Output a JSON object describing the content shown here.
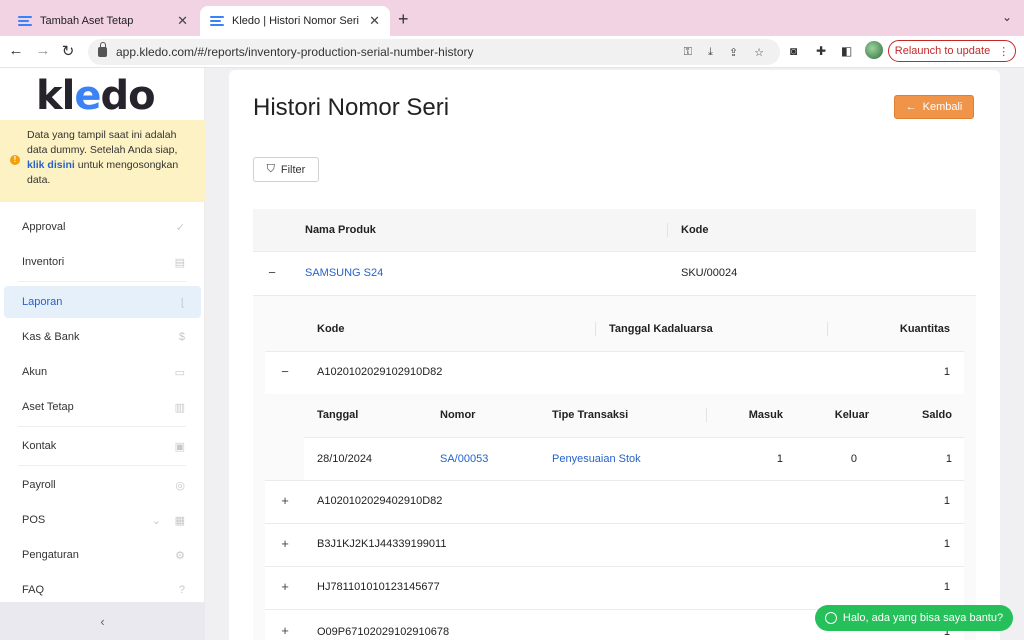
{
  "browser": {
    "tabs": [
      {
        "title": "Tambah Aset Tetap",
        "active": false
      },
      {
        "title": "Kledo | Histori Nomor Seri",
        "active": true
      }
    ],
    "url": "app.kledo.com/#/reports/inventory-production-serial-number-history",
    "relaunch_label": "Relaunch to update"
  },
  "sidebar": {
    "logo_pre": "kl",
    "logo_e": "e",
    "logo_post": "do",
    "notice": {
      "text_1": "Data yang tampil saat ini adalah data dummy. Setelah Anda siap,",
      "link": "klik disini",
      "text_2": "untuk mengosongkan data."
    },
    "items": [
      {
        "label": "Approval",
        "icon": "check-icon"
      },
      {
        "label": "Inventori",
        "icon": "box-icon"
      },
      {
        "label": "Laporan",
        "icon": "chart-icon",
        "active": true
      },
      {
        "label": "Kas & Bank",
        "icon": "dollar-icon"
      },
      {
        "label": "Akun",
        "icon": "list-icon"
      },
      {
        "label": "Aset Tetap",
        "icon": "building-icon"
      },
      {
        "label": "Kontak",
        "icon": "contact-card-icon"
      },
      {
        "label": "Payroll",
        "icon": "payroll-icon"
      },
      {
        "label": "POS",
        "icon": "pos-icon"
      },
      {
        "label": "Pengaturan",
        "icon": "gears-icon"
      },
      {
        "label": "FAQ",
        "icon": "question-icon"
      }
    ],
    "collapse_icon": "‹"
  },
  "page": {
    "title": "Histori Nomor Seri",
    "back_label": "Kembali",
    "filter_label": "Filter"
  },
  "product_table": {
    "headers": {
      "name": "Nama Produk",
      "code": "Kode"
    },
    "row": {
      "name": "SAMSUNG S24",
      "code": "SKU/00024",
      "toggle": "−"
    }
  },
  "serial_table": {
    "headers": {
      "code": "Kode",
      "expiry": "Tanggal Kadaluarsa",
      "qty": "Kuantitas"
    },
    "rows": [
      {
        "code": "A1020102029102910D82",
        "qty": "1",
        "toggle": "−"
      },
      {
        "code": "A1020102029402910D82",
        "qty": "1",
        "toggle": "+"
      },
      {
        "code": "B3J1KJ2K1J44339199011",
        "qty": "1",
        "toggle": "+"
      },
      {
        "code": "HJ781101010123145677",
        "qty": "1",
        "toggle": "+"
      },
      {
        "code": "O09P67102029102910678",
        "qty": "1",
        "toggle": "+"
      }
    ]
  },
  "transaction_table": {
    "headers": {
      "date": "Tanggal",
      "number": "Nomor",
      "type": "Tipe Transaksi",
      "in": "Masuk",
      "out": "Keluar",
      "balance": "Saldo"
    },
    "rows": [
      {
        "date": "28/10/2024",
        "number": "SA/00053",
        "type": "Penyesuaian Stok",
        "in": "1",
        "out": "0",
        "balance": "1"
      }
    ]
  },
  "whatsapp_label": "Halo, ada yang bisa saya bantu?"
}
